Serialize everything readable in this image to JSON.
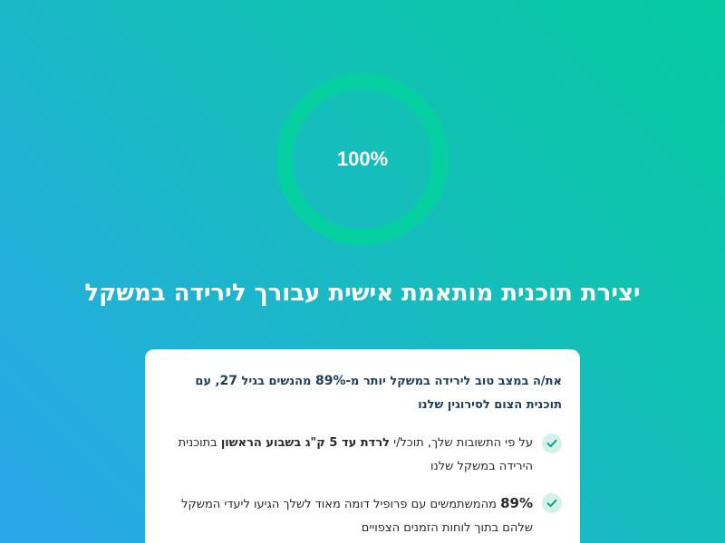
{
  "progress": {
    "label": "100%",
    "value": 1.0,
    "track_color": "#10c5b3",
    "fill_color": "#05cfa0"
  },
  "headline": "יצירת תוכנית מותאמת אישית עבורך לירידה במשקל",
  "card": {
    "intro": {
      "part1": "את/ה במצב טוב לירידה במשקל יותר מ-",
      "pct": "89%",
      "part2": " מהנשים בגיל ",
      "age": "27",
      "part3": ", עם תוכנית הצום לסירוגין שלנו"
    },
    "items": [
      {
        "icon": "check-icon",
        "pre": "על פי התשובות שלך, תוכל/י ",
        "bold": "לרדת עד 5 ק\"ג בשבוע הראשון",
        "post": " בתוכנית הירידה במשקל שלנו"
      },
      {
        "icon": "check-icon",
        "pct": "89%",
        "post": " מהמשתמשים עם פרופיל דומה מאוד לשלך הגיעו ליעדי המשקל שלהם בתוך לוחות הזמנים הצפויים"
      }
    ]
  },
  "colors": {
    "text_dark": "#1c3d5a",
    "check_bg": "#d3f1ea",
    "check_mark": "#0aa37f"
  }
}
